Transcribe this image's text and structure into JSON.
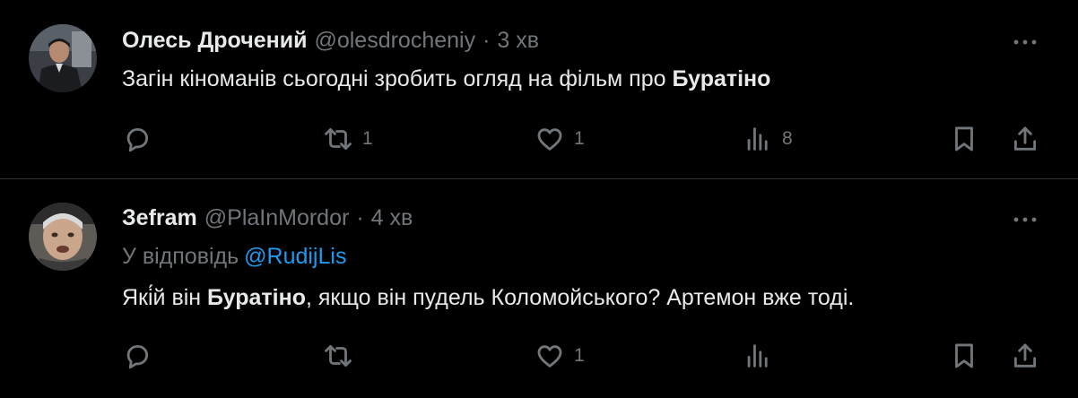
{
  "tweets": [
    {
      "author_name": "Олесь Дрочений",
      "handle": "@olesdrocheniy",
      "separator": "·",
      "time": "3 хв",
      "text_parts": [
        "Загін кіноманів сьогодні зробить огляд на фільм про ",
        "Буратіно"
      ],
      "counts": {
        "reply": "",
        "retweet": "1",
        "like": "1",
        "views": "8"
      },
      "icons": {
        "avatar": "user-avatar",
        "more": "more-icon",
        "reply": "reply-icon",
        "retweet": "retweet-icon",
        "like": "heart-icon",
        "views": "views-icon",
        "bookmark": "bookmark-icon",
        "share": "share-icon"
      }
    },
    {
      "author_name": "Зefram",
      "handle": "@PlaInMordor",
      "separator": "·",
      "time": "4 хв",
      "reply_to_label": "У відповідь",
      "reply_to_mention": "@RudijLis",
      "text_parts": [
        "Які́й він ",
        "Буратіно",
        ", якщо він пудель Коломойського? Артемон вже тоді."
      ],
      "counts": {
        "reply": "",
        "retweet": "",
        "like": "1",
        "views": ""
      },
      "icons": {
        "avatar": "user-avatar",
        "more": "more-icon",
        "reply": "reply-icon",
        "retweet": "retweet-icon",
        "like": "heart-icon",
        "views": "views-icon",
        "bookmark": "bookmark-icon",
        "share": "share-icon"
      }
    }
  ],
  "colors": {
    "background": "#000000",
    "primary_text": "#e7e9ea",
    "secondary_text": "#71767b",
    "link": "#1d9bf0",
    "divider": "#2f3336"
  }
}
